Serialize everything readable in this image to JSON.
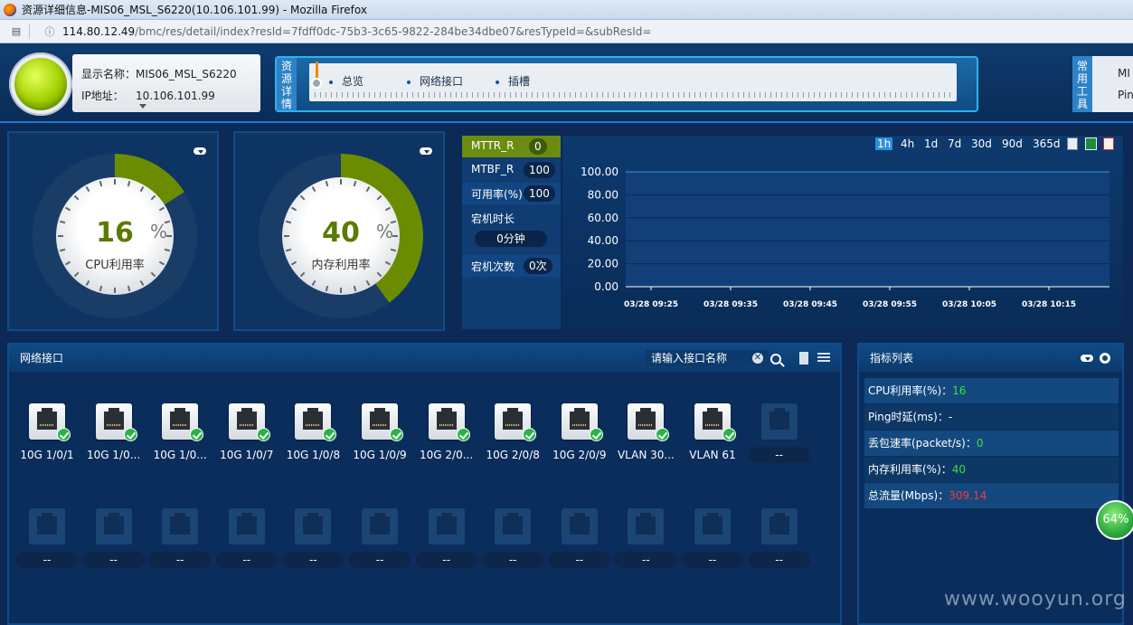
{
  "window": {
    "title": "资源详细信息-MIS06_MSL_S6220(10.106.101.99) - Mozilla Firefox"
  },
  "address": {
    "host": "114.80.12.49",
    "path": "/bmc/res/detail/index?resId=7fdff0dc-75b3-3c65-9822-284be34dbe07&resTypeId=&subResId="
  },
  "device": {
    "name_label": "显示名称：",
    "name_value": "MIS06_MSL_S6220",
    "ip_label": "IP地址：",
    "ip_value": "10.106.101.99"
  },
  "nav": {
    "side_label": "资源详情",
    "items": [
      "总览",
      "网络接口",
      "插槽"
    ]
  },
  "tools": {
    "side_label": "常用工具",
    "items": [
      "MI",
      "Pin"
    ]
  },
  "cpu": {
    "value": "16",
    "unit": "%",
    "label": "CPU利用率",
    "level": 16
  },
  "memory": {
    "value": "40",
    "unit": "%",
    "label": "内存利用率",
    "level": 40
  },
  "metrics": {
    "mttr_label": "MTTR_R",
    "mttr_value": "0",
    "mtbf_label": "MTBF_R",
    "mtbf_value": "100",
    "avail_label": "可用率(%)",
    "avail_value": "100",
    "downtime_label": "宕机时长",
    "downtime_value": "0分钟",
    "downcount_label": "宕机次数",
    "downcount_value": "0次"
  },
  "ranges": [
    "1h",
    "4h",
    "1d",
    "7d",
    "30d",
    "90d",
    "365d"
  ],
  "chart_data": {
    "type": "area",
    "x": [
      "03/28 09:25",
      "03/28 09:35",
      "03/28 09:45",
      "03/28 09:55",
      "03/28 10:05",
      "03/28 10:15"
    ],
    "yticks": [
      "100.00",
      "80.00",
      "60.00",
      "40.00",
      "20.00",
      "0.00"
    ],
    "ylim": [
      0,
      100
    ],
    "series": [
      {
        "values": [
          100,
          100,
          100,
          100,
          100,
          100
        ]
      }
    ],
    "grid": true,
    "colors": {
      "fill": "#123f78",
      "line": "#4a90d6"
    }
  },
  "interfaces": {
    "title": "网络接口",
    "search_placeholder": "请输入接口名称",
    "clear": "✕",
    "ports_row1": [
      {
        "label": "10G 1/0/1",
        "up": true
      },
      {
        "label": "10G 1/0...",
        "up": true
      },
      {
        "label": "10G 1/0...",
        "up": true
      },
      {
        "label": "10G 1/0/7",
        "up": true
      },
      {
        "label": "10G 1/0/8",
        "up": true
      },
      {
        "label": "10G 1/0/9",
        "up": true
      },
      {
        "label": "10G 2/0...",
        "up": true
      },
      {
        "label": "10G 2/0/8",
        "up": true
      },
      {
        "label": "10G 2/0/9",
        "up": true
      },
      {
        "label": "VLAN 30...",
        "up": true
      },
      {
        "label": "VLAN 61",
        "up": true
      },
      {
        "label": "--",
        "up": false
      }
    ],
    "ports_row2_label": "--"
  },
  "kpis": {
    "title": "指标列表",
    "rows": [
      {
        "label": "CPU利用率(%)：",
        "value": "16",
        "color": "#3adf3a"
      },
      {
        "label": "Ping时延(ms)：",
        "value": "-",
        "color": "#ffffff"
      },
      {
        "label": "丢包速率(packet/s)：",
        "value": "0",
        "color": "#3adf3a"
      },
      {
        "label": "内存利用率(%)：",
        "value": "40",
        "color": "#3adf3a"
      },
      {
        "label": "总流量(Mbps)：",
        "value": "309.14",
        "color": "#ff3838"
      }
    ]
  },
  "perf_badge": "64%",
  "watermark": "www.wooyun.org",
  "colors": {
    "accent": "#2fb1ee",
    "gauge_arc": "#6b8c00",
    "background": "#0c2a55"
  }
}
